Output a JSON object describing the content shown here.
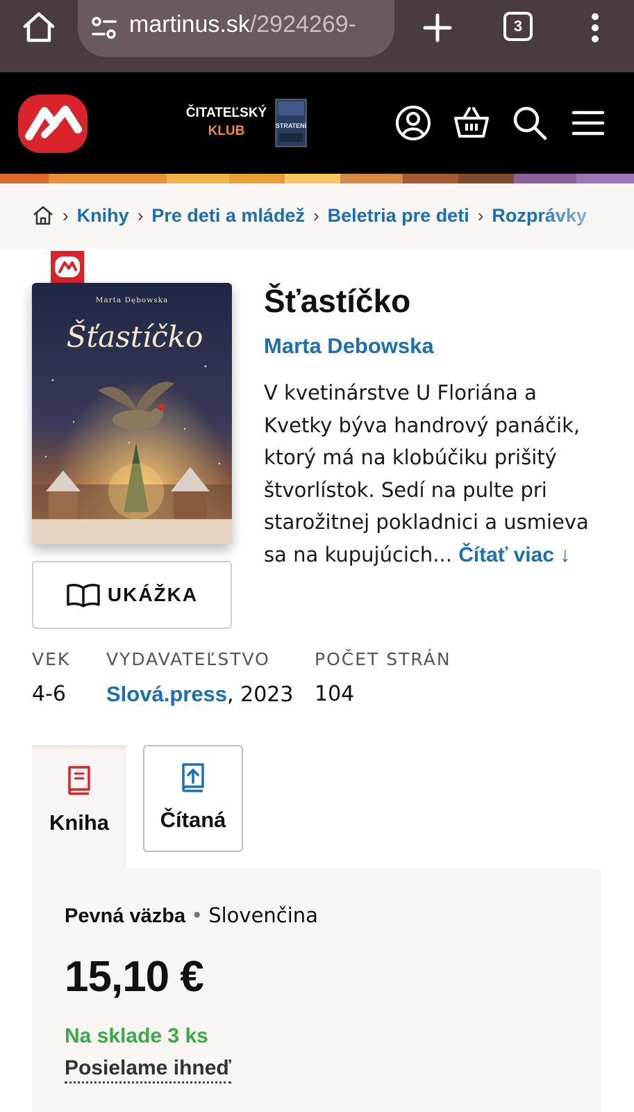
{
  "browser": {
    "url_domain": "martinus.sk",
    "url_path": "/2924269-",
    "tab_count": "3",
    "icons": [
      "home-icon",
      "site-settings-icon",
      "new-tab-icon",
      "tab-switcher-icon",
      "more-menu-icon"
    ]
  },
  "header": {
    "club_line1": "ČITATEĽSKÝ",
    "club_line2": "KLUB",
    "club_book_text": "STRATENÍ",
    "icons": [
      "account-icon",
      "basket-icon",
      "search-icon",
      "hamburger-menu-icon"
    ],
    "colors": {
      "logo_red": "#d8242a",
      "club_orange": "#f08a3c"
    }
  },
  "breadcrumb": [
    "Knihy",
    "Pre deti a mládež",
    "Beletria pre deti",
    "Rozprávky"
  ],
  "product": {
    "cover": {
      "author": "Marta Dębowska",
      "title": "Šťastíčko"
    },
    "sample_label": "UKÁŽKA",
    "title": "Šťastíčko",
    "author": "Marta Debowska",
    "description": "V kvetinárstve U Floriána a Kvetky býva handrový panáčik, ktorý má na klobúčiku prišitý štvorlístok. Sedí na pulte pri starožitnej pokladnici a usmieva sa na kupujúcich...",
    "read_more": "Čítať viac ↓"
  },
  "meta": {
    "age_label": "VEK",
    "age_value": "4-6",
    "publisher_label": "VYDAVATEĽSTVO",
    "publisher_name": "Slová.press",
    "publisher_year": ", 2023",
    "pages_label": "POČET STRÁN",
    "pages_value": "104"
  },
  "tabs": [
    {
      "label": "Kniha",
      "icon": "book-icon",
      "active": true
    },
    {
      "label": "Čítaná",
      "icon": "audiobook-icon",
      "active": false
    }
  ],
  "offer": {
    "binding": "Pevná väzba",
    "separator": "•",
    "language": "Slovenčina",
    "price": "15,10 €",
    "stock": "Na sklade 3 ks",
    "shipping": "Posielame ihneď",
    "colors": {
      "stock_green": "#3aaa4a",
      "link_blue": "#1b6fb3"
    }
  }
}
